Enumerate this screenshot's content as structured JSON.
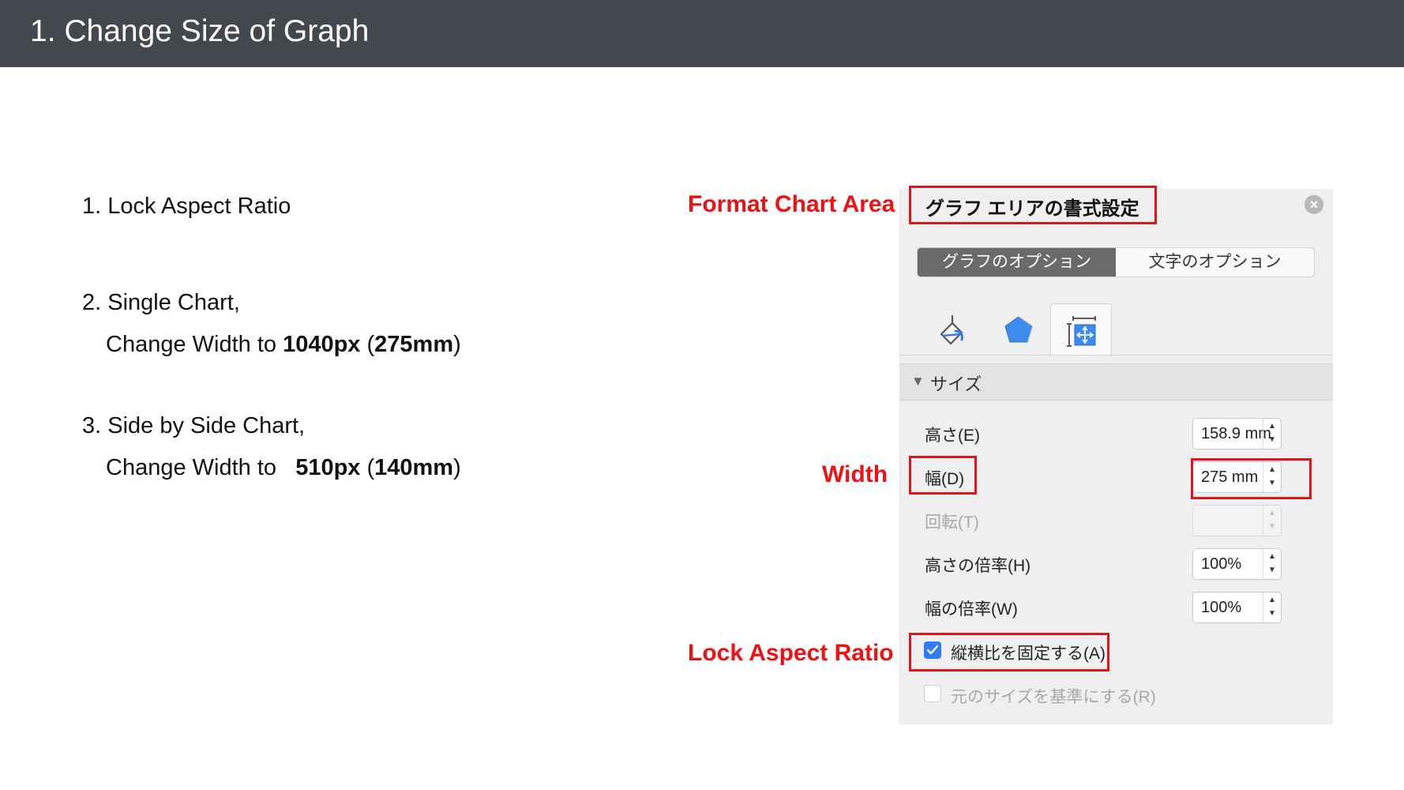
{
  "header": {
    "title": "1. Change Size of Graph"
  },
  "steps": {
    "step1": "1. Lock Aspect Ratio",
    "step2_line1": "2. Single Chart,",
    "step2_prefix": "Change Width to ",
    "step2_px": "1040px",
    "step2_mm": "275mm",
    "step3_line1": "3. Side by Side Chart,",
    "step3_prefix": "Change Width to",
    "step3_px": "510px",
    "step3_mm": "140mm"
  },
  "annotations": {
    "format_chart_area": "Format Chart Area",
    "width": "Width",
    "lock_aspect_ratio": "Lock Aspect Ratio"
  },
  "panel": {
    "title": "グラフ エリアの書式設定",
    "close_glyph": "×",
    "tabs": [
      {
        "label": "グラフのオプション",
        "active": true
      },
      {
        "label": "文字のオプション",
        "active": false
      }
    ],
    "icon_tabs": [
      "paint-bucket-icon",
      "pentagon-icon",
      "size-properties-icon"
    ],
    "section": {
      "toggle": "▼",
      "label": "サイズ"
    },
    "fields": {
      "height": {
        "label": "高さ(E)",
        "value": "158.9 mm"
      },
      "width": {
        "label": "幅(D)",
        "value": "275 mm"
      },
      "rotation": {
        "label": "回転(T)",
        "value": ""
      },
      "scale_height": {
        "label": "高さの倍率(H)",
        "value": "100%"
      },
      "scale_width": {
        "label": "幅の倍率(W)",
        "value": "100%"
      }
    },
    "checkboxes": {
      "lock_aspect": {
        "label": "縦横比を固定する(A)",
        "checked": true
      },
      "relative_original": {
        "label": "元のサイズを基準にする(R)",
        "checked": false
      }
    },
    "spin_up": "▲",
    "spin_down": "▼"
  },
  "colors": {
    "header_bg": "#45474e",
    "annotation_red": "#ee1111",
    "checkbox_blue": "#2f7cf6",
    "panel_bg": "#efefef"
  }
}
